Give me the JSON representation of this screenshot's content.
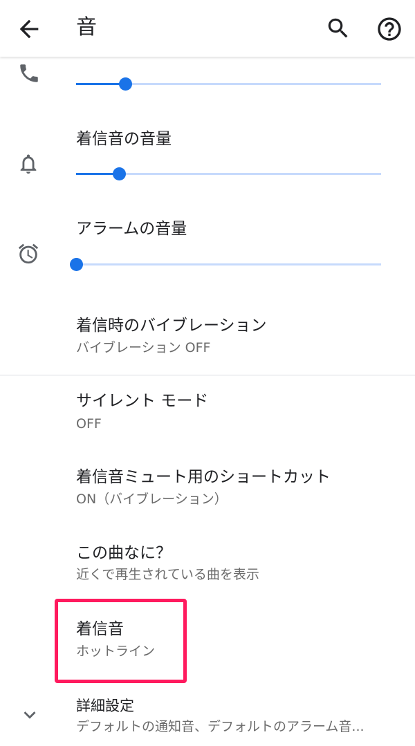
{
  "appbar": {
    "title": "音",
    "back_icon": "arrow-back-icon",
    "search_icon": "search-icon",
    "help_icon": "help-icon"
  },
  "settings": {
    "call_volume": {
      "icon": "phone-icon",
      "level": 0.16
    },
    "ring_volume": {
      "label": "着信音の音量",
      "icon": "bell-icon",
      "level": 0.14
    },
    "alarm_volume": {
      "label": "アラームの音量",
      "icon": "alarm-icon",
      "level": 0.0
    },
    "vibrate_on_ring": {
      "label": "着信時のバイブレーション",
      "summary": "バイブレーション OFF"
    },
    "silent_mode": {
      "label": "サイレント モード",
      "summary": "OFF"
    },
    "mute_shortcut": {
      "label": "着信音ミュート用のショートカット",
      "summary": "ON（バイブレーション）"
    },
    "now_playing": {
      "label": "この曲なに？",
      "summary": "近くで再生されている曲を表示"
    },
    "ringtone": {
      "label": "着信音",
      "summary": "ホットライン"
    },
    "advanced": {
      "label": "詳細設定",
      "summary": "デフォルトの通知音、デフォルトのアラーム音...",
      "icon": "chevron-down-icon"
    }
  },
  "colors": {
    "accent": "#1a73e8",
    "track": "#c6dafc",
    "highlight": "#ff1a5e"
  }
}
